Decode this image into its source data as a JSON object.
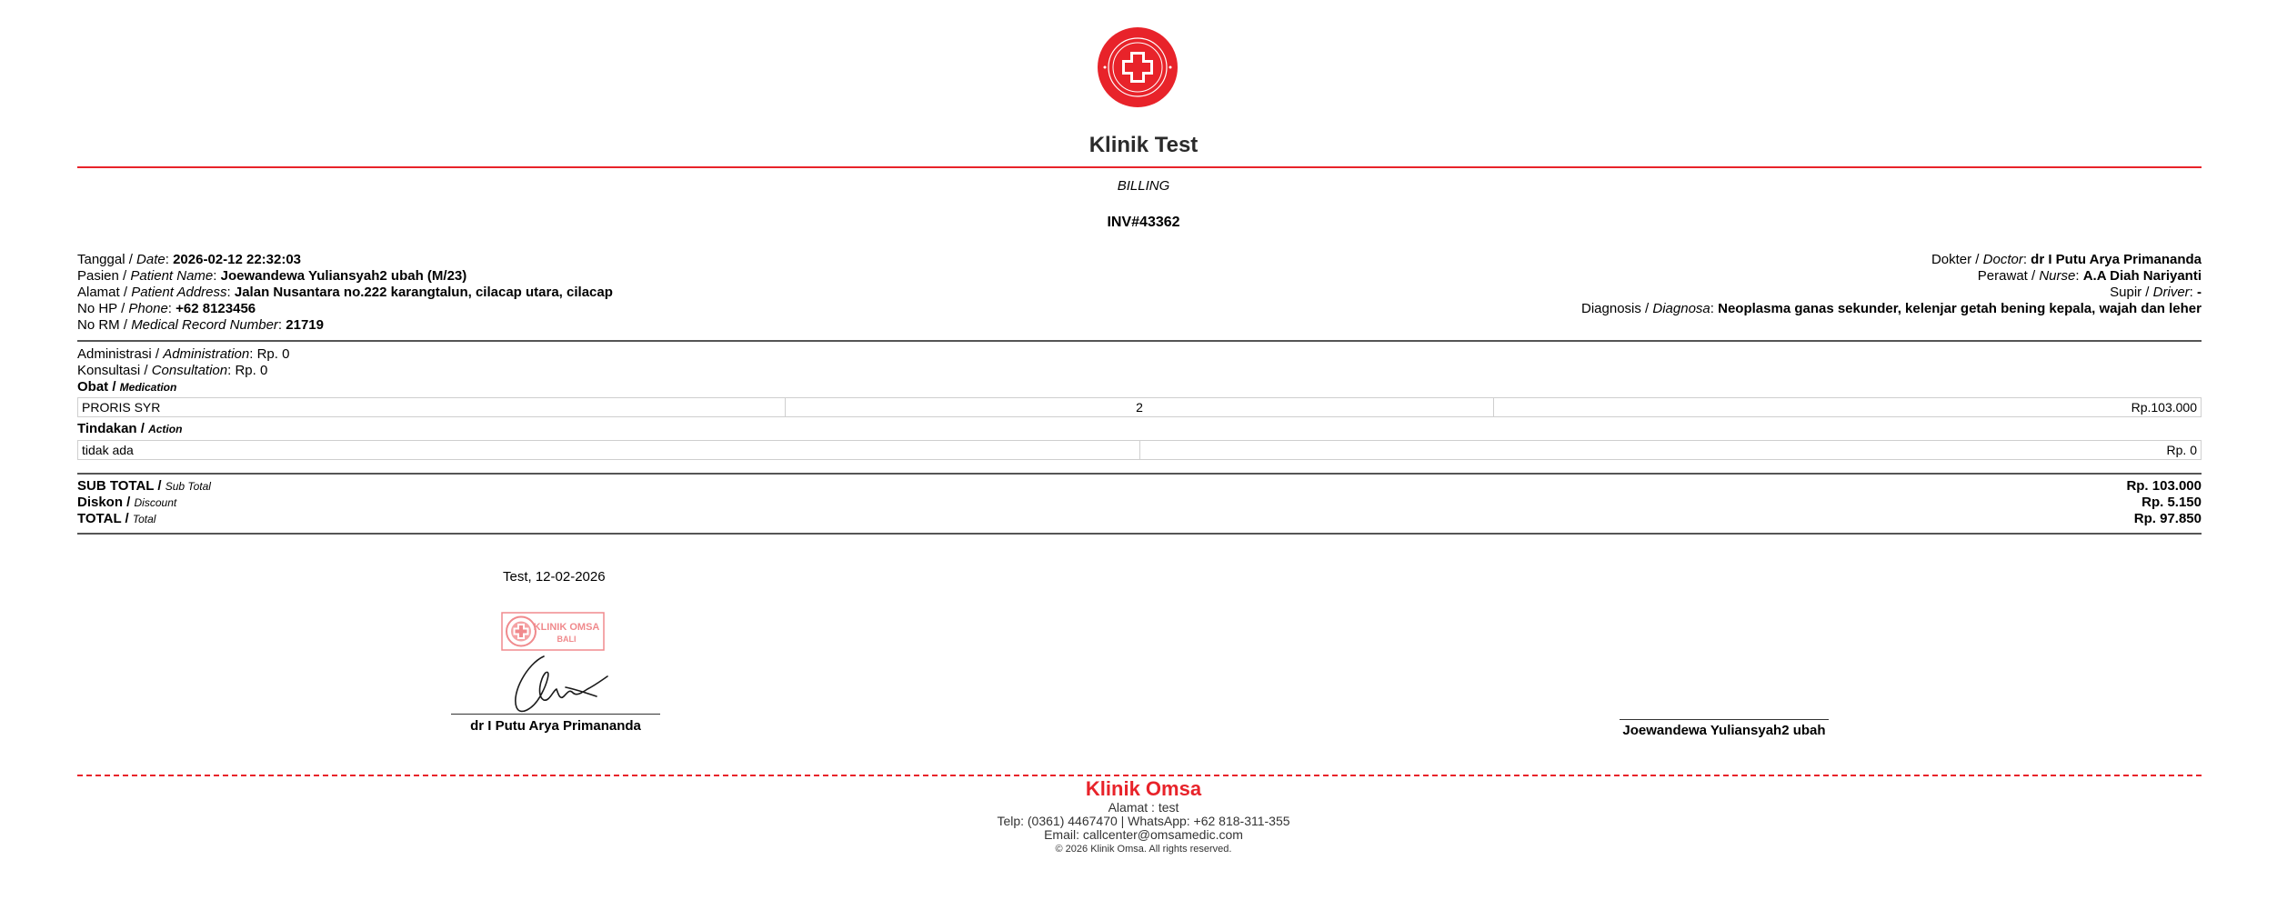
{
  "header": {
    "logo_ring_text": "OMSA MEDIC DEWATA",
    "clinic_name": "Klinik Test",
    "doc_type": "BILLING",
    "invoice_no": "INV#43362",
    "accent_color": "#e8232a"
  },
  "patient_info": {
    "date_label": "Tanggal / ",
    "date_label_en": "Date",
    "date": "2026-02-12 22:32:03",
    "patient_label": "Pasien / ",
    "patient_label_en": "Patient Name",
    "patient": "Joewandewa Yuliansyah2 ubah (M/23)",
    "address_label": "Alamat / ",
    "address_label_en": "Patient Address",
    "address": "Jalan Nusantara no.222 karangtalun, cilacap utara, cilacap",
    "phone_label": "No HP / ",
    "phone_label_en": "Phone",
    "phone": "+62 8123456",
    "rm_label": "No RM / ",
    "rm_label_en": "Medical Record Number",
    "rm": "21719"
  },
  "staff_info": {
    "doctor_label": "Dokter / ",
    "doctor_label_en": "Doctor",
    "doctor": "dr I Putu Arya Primananda",
    "nurse_label": "Perawat / ",
    "nurse_label_en": "Nurse",
    "nurse": "A.A Diah Nariyanti",
    "driver_label": "Supir / ",
    "driver_label_en": "Driver",
    "driver": "-",
    "diagnosis_label": "Diagnosis / ",
    "diagnosis_label_en": "Diagnosa",
    "diagnosis": "Neoplasma ganas sekunder, kelenjar getah bening kepala, wajah dan leher"
  },
  "costs": {
    "admin": "Administrasi / ",
    "admin_en": "Administration",
    "admin_value": "Rp. 0",
    "consult": "Konsultasi / ",
    "consult_en": "Consultation",
    "consult_value": "Rp. 0",
    "medication_h": "Obat / ",
    "medication_h_en": "Medication",
    "medications": [
      {
        "name": "PRORIS SYR",
        "qty": "2",
        "price": "Rp.103.000"
      }
    ],
    "action_h": "Tindakan / ",
    "action_h_en": "Action",
    "actions": [
      {
        "name": "tidak ada",
        "price": "Rp. 0"
      }
    ]
  },
  "totals": {
    "subtotal_label": "SUB TOTAL / ",
    "subtotal_label_en": "Sub Total",
    "subtotal": "Rp. 103.000",
    "discount_label": "Diskon / ",
    "discount_label_en": "Discount",
    "discount": "Rp. 5.150",
    "total_label": "TOTAL / ",
    "total_label_en": "Total",
    "total": "Rp. 97.850"
  },
  "signatures": {
    "place_date": "Test, 12-02-2026",
    "stamp_text": "KLINIK OMSA",
    "stamp_subtext": "BALI",
    "doctor_name": "dr I Putu Arya Primananda",
    "patient_name": "Joewandewa Yuliansyah2 ubah"
  },
  "footer": {
    "clinic": "Klinik Omsa",
    "address": "Alamat : test",
    "contact": "Telp: (0361) 4467470 | WhatsApp: +62 818-311-355",
    "email": "Email: callcenter@omsamedic.com",
    "copyright": "© 2026 Klinik Omsa. All rights reserved."
  }
}
